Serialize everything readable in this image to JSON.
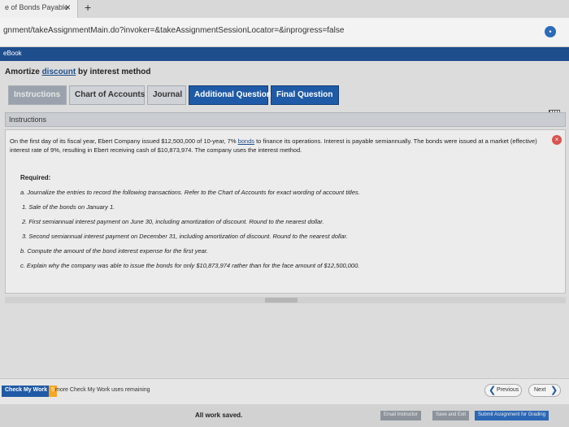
{
  "browser": {
    "tab_title": "e of Bonds Payable",
    "tab_close": "×",
    "new_tab": "+",
    "url": "gnment/takeAssignmentMain.do?invoker=&takeAssignmentSessionLocator=&inprogress=false"
  },
  "ebook": {
    "label": "eBook"
  },
  "page": {
    "title_prefix": "Amortize ",
    "title_link": "discount",
    "title_suffix": " by interest method"
  },
  "tabs": [
    {
      "label": "Instructions",
      "state": "active"
    },
    {
      "label": "Chart of Accounts",
      "state": "normal"
    },
    {
      "label": "Journal",
      "state": "normal"
    },
    {
      "label": "Additional Question",
      "state": "blue"
    },
    {
      "label": "Final Question",
      "state": "blue"
    }
  ],
  "instructions": {
    "header": "Instructions",
    "close": "×",
    "intro_before_link": "On the first day of its fiscal year, Ebert Company issued $12,500,000 of 10-year, 7% ",
    "intro_link": "bonds",
    "intro_after_link": " to finance its operations. Interest is payable semiannually. The bonds were issued at a market (effective) interest rate of 9%, resulting in Ebert receiving cash of $10,873,974. The company uses the interest method.",
    "required_label": "Required:",
    "items": [
      "a. Journalize the entries to record the following transactions. Refer to the Chart of Accounts for exact wording of account titles.",
      "1.  Sale of the bonds on January 1.",
      "2.  First semiannual interest payment on June 30, including amortization of discount. Round to the nearest dollar.",
      "3.  Second semiannual interest payment on December 31, including amortization of discount. Round to the nearest dollar.",
      "b. Compute the amount of the bond interest expense for the first year.",
      "c. Explain why the company was able to issue the bonds for only $10,873,974 rather than for the face amount of $12,500,000."
    ]
  },
  "bottom": {
    "check_label": "Check My Work",
    "check_count": "5",
    "check_text": "more Check My Work uses remaining",
    "previous": "Previous",
    "next": "Next",
    "arrow_prev": "❮",
    "arrow_next": "❯"
  },
  "footer": {
    "saved": "All work saved.",
    "email": "Email Instructor",
    "save_exit": "Save and Exit",
    "submit": "Submit Assignment for Grading"
  },
  "colors": {
    "brand_blue": "#1f5aa6",
    "ebook_strip": "#1f4e8c",
    "close_red": "#d9534f"
  }
}
